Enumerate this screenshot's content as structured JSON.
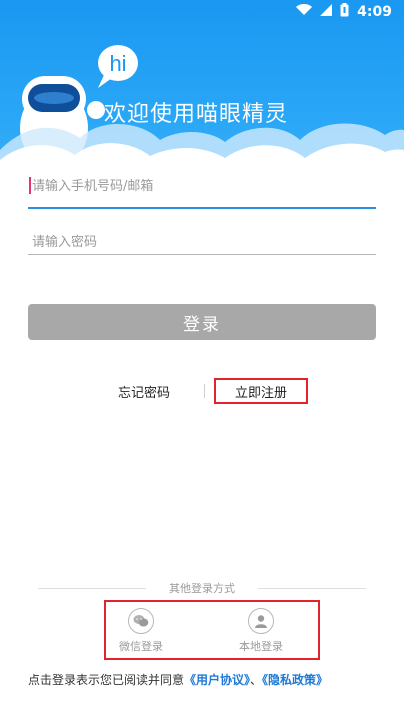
{
  "status_bar": {
    "time": "4:09",
    "icons": [
      "wifi-icon",
      "signal-icon",
      "battery-icon"
    ]
  },
  "header": {
    "title": "欢迎使用喵眼精灵",
    "bubble_text": "hi",
    "mascot": "robot-mascot-icon"
  },
  "form": {
    "phone_placeholder": "请输入手机号码/邮箱",
    "password_placeholder": "请输入密码",
    "login_button": "登录"
  },
  "links": {
    "forgot_password": "忘记密码",
    "register_now": "立即注册"
  },
  "other_login": {
    "title": "其他登录方式",
    "options": [
      {
        "label": "微信登录",
        "icon": "wechat-icon"
      },
      {
        "label": "本地登录",
        "icon": "user-icon"
      }
    ]
  },
  "agreement": {
    "prefix": "点击登录表示您已阅读并同意",
    "user_agreement": "《用户协议》",
    "separator": "、",
    "privacy_policy": "《隐私政策》"
  },
  "colors": {
    "header_blue": "#1a98f2",
    "button_gray": "#a8a8a8",
    "highlight_red": "#e0232d",
    "link_blue": "#1f7ad6"
  }
}
